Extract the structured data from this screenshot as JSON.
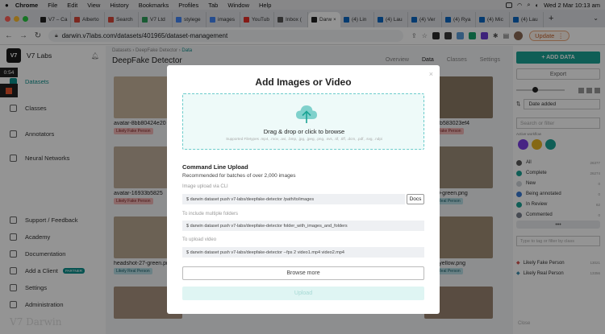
{
  "menubar": {
    "apple": "",
    "items": [
      "Chrome",
      "File",
      "Edit",
      "View",
      "History",
      "Bookmarks",
      "Profiles",
      "Tab",
      "Window",
      "Help"
    ],
    "datetime": "Wed 2 Mar 10:13 am"
  },
  "tabs": [
    {
      "label": "V7 – Ca",
      "color": "#222222"
    },
    {
      "label": "Alberto",
      "color": "#d44638"
    },
    {
      "label": "Search",
      "color": "#d44638"
    },
    {
      "label": "V7 Ltd",
      "color": "#2e9e5b"
    },
    {
      "label": "stylege",
      "color": "#4285f4"
    },
    {
      "label": "images",
      "color": "#4285f4"
    },
    {
      "label": "YouTub",
      "color": "#e52d27"
    },
    {
      "label": "Inbox (",
      "color": "#555555"
    },
    {
      "label": "Darw",
      "color": "#222222",
      "active": true
    },
    {
      "label": "(4) Lin",
      "color": "#0a66c2"
    },
    {
      "label": "(4) Lau",
      "color": "#0a66c2"
    },
    {
      "label": "(4) Ver",
      "color": "#0a66c2"
    },
    {
      "label": "(4) Rya",
      "color": "#0a66c2"
    },
    {
      "label": "(4) Mic",
      "color": "#0a66c2"
    },
    {
      "label": "(4) Lau",
      "color": "#0a66c2"
    }
  ],
  "browser": {
    "url": "darwin.v7labs.com/datasets/401965/dataset-management",
    "update_label": "Update"
  },
  "sidebar": {
    "logo": "V7",
    "brand": "V7 Labs",
    "items": [
      {
        "label": "Datasets",
        "active": true
      },
      {
        "label": "Classes"
      },
      {
        "label": "Annotators"
      },
      {
        "label": "Neural Networks"
      },
      {
        "label": "Support / Feedback"
      },
      {
        "label": "Academy"
      },
      {
        "label": "Documentation"
      },
      {
        "label": "Add a Client",
        "badge": "PARTNER"
      },
      {
        "label": "Settings"
      },
      {
        "label": "Administration"
      }
    ],
    "timer": "0:54",
    "footer": "V7 Darwin"
  },
  "main": {
    "breadcrumb": {
      "a": "Datasets",
      "b": "DeepFake Detector",
      "c": "Data"
    },
    "title": "DeepFake Detector",
    "tabs": [
      "Overview",
      "Data",
      "Classes",
      "Settings"
    ],
    "cards": [
      {
        "name": "avatar-8bb80424e20",
        "tag": "Likely Fake Person",
        "kind": "fake"
      },
      {
        "name": "avatar-16933b5825",
        "tag": "Likely Fake Person",
        "kind": "fake"
      },
      {
        "name": "headshot-27-green.pn",
        "tag": "Likely Real Person",
        "kind": "real"
      },
      {
        "name": "-ef1ccb583023ef4",
        "tag": "Likely Fake Person",
        "kind": "fake"
      },
      {
        "name": "hot-10-green.png",
        "tag": "Likely Real Person",
        "kind": "real"
      },
      {
        "name": "hot-2-yellow.png",
        "tag": "Likely Real Person",
        "kind": "real"
      }
    ]
  },
  "rpanel": {
    "add_data": "+ ADD DATA",
    "export": "Export",
    "sort": "Date added",
    "filter_placeholder": "Search or filter",
    "active_workflow": "Active workflow",
    "stats": [
      {
        "label": "All",
        "num": "26377",
        "color": "#5b5b5b"
      },
      {
        "label": "Complete",
        "num": "26274",
        "color": "#1aa394"
      },
      {
        "label": "New",
        "num": "0",
        "color": "#cfd4da"
      },
      {
        "label": "Being annotated",
        "num": "0",
        "color": "#3a7bd5"
      },
      {
        "label": "In Review",
        "num": "62",
        "color": "#1aa394"
      },
      {
        "label": "Commented",
        "num": "0",
        "color": "#7a8290"
      }
    ],
    "more": "•••",
    "class_placeholder": "Type to tag or filter by class",
    "classes": [
      {
        "label": "Likely Fake Person",
        "num": "13021"
      },
      {
        "label": "Likely Real Person",
        "num": "13356"
      }
    ],
    "bottom": "Close"
  },
  "modal": {
    "title": "Add Images or Video",
    "close": "×",
    "dropzone_title": "Drag & drop or click to browse",
    "dropzone_sub": "Supported Filetypes .mp4, .mov, .avi, .bmp, .jpg, .jpeg, .png, .svs, .tif, .tiff, .dcm, .pdf, .svg, .ndpi",
    "cli_title": "Command Line Upload",
    "cli_desc": "Recommended for batches of over 2,000 images",
    "label_1": "Image upload via CLI",
    "cmd_1": "$ darwin dataset push v7-labs/deepfake-detector /path/to/images",
    "docs": "Docs",
    "label_2": "To include multiple folders",
    "cmd_2": "$ darwin dataset push v7-labs/deepfake-detector folder_with_images_and_folders",
    "label_3": "To upload video",
    "cmd_3": "$ darwin dataset push v7-labs/deepfake-detector --fps 2 video1.mp4 video2.mp4",
    "browse": "Browse more",
    "upload": "Upload"
  }
}
